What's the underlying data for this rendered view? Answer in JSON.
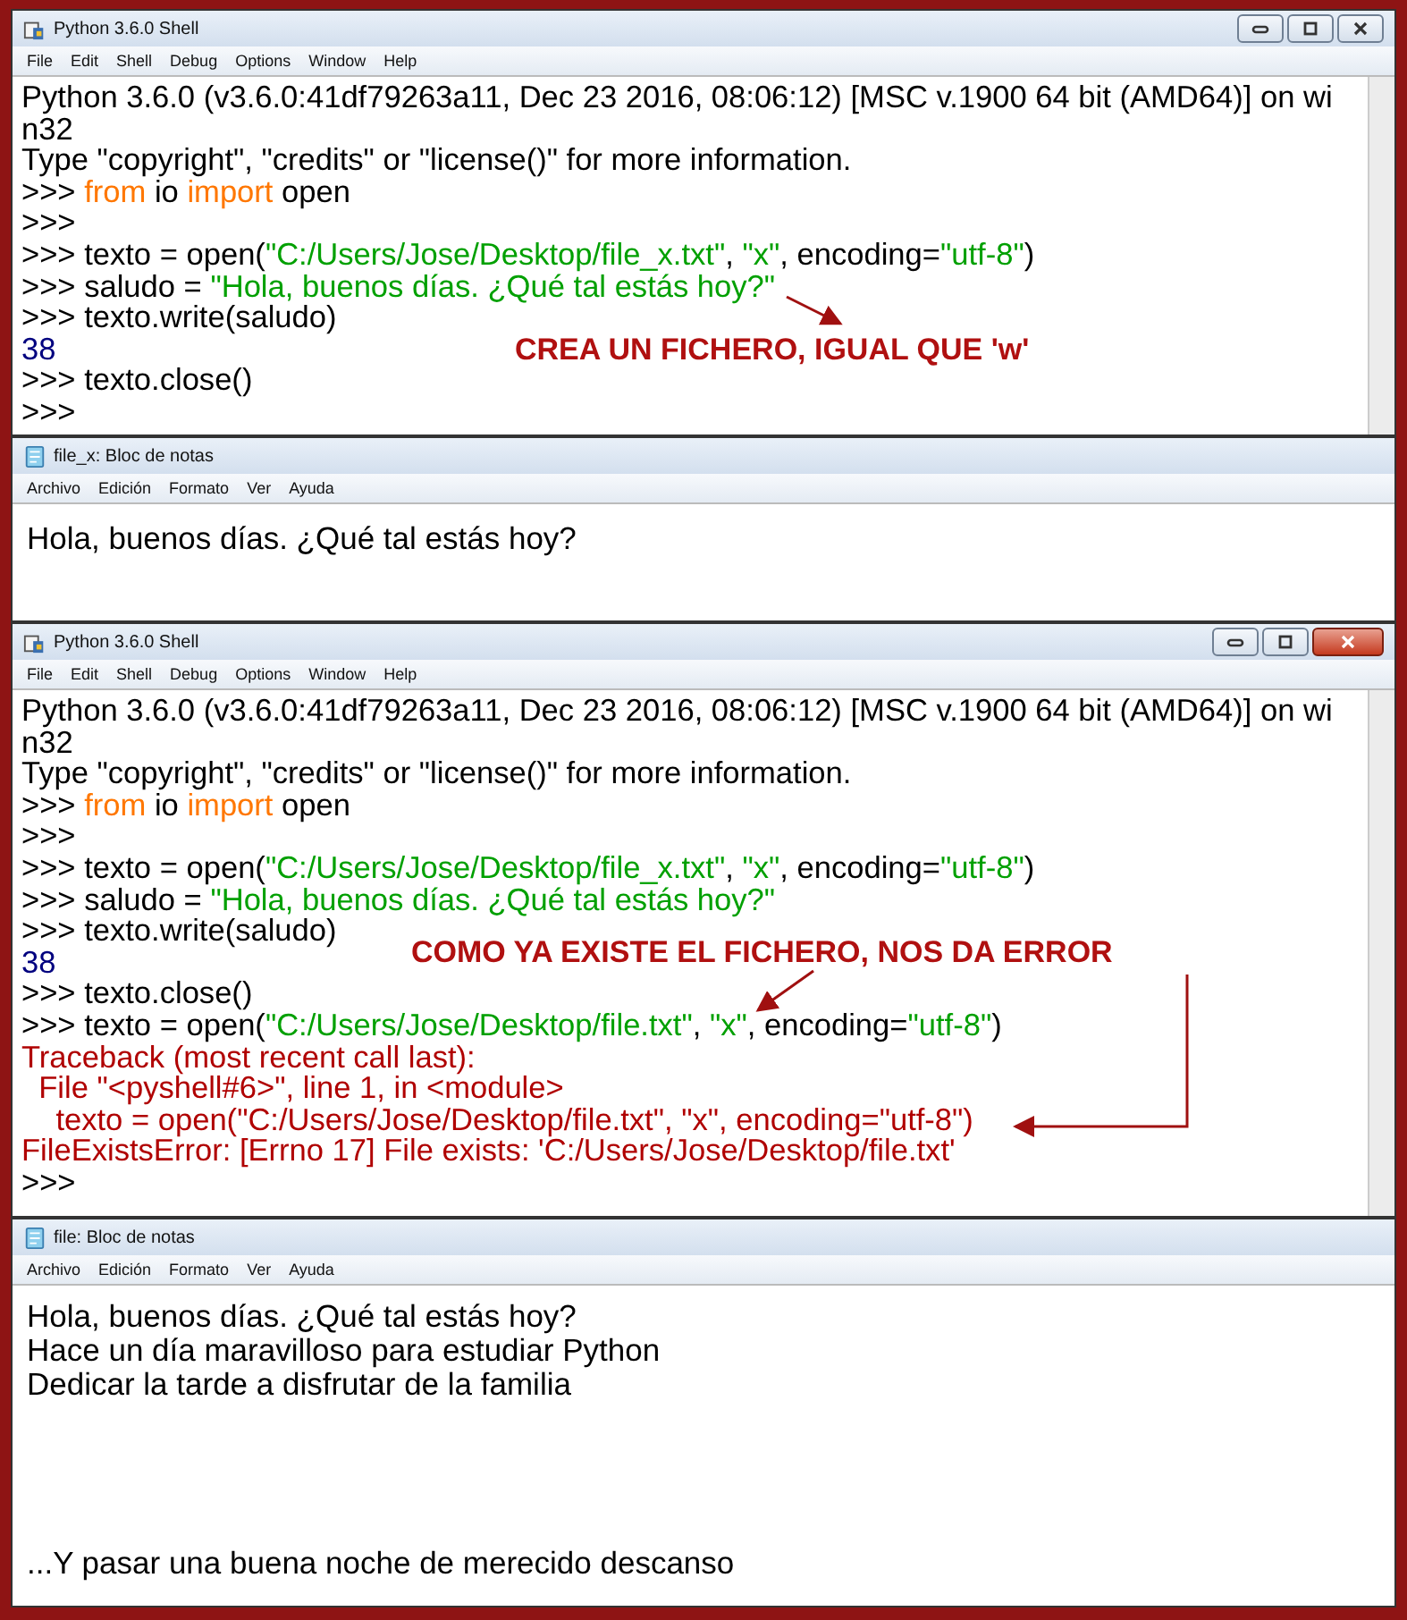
{
  "windows": [
    {
      "kind": "shell",
      "title": "Python 3.6.0 Shell",
      "active": false,
      "menu": [
        "File",
        "Edit",
        "Shell",
        "Debug",
        "Options",
        "Window",
        "Help"
      ],
      "lines": [
        {
          "segments": [
            {
              "kind": "plain",
              "text": "Python 3.6.0 (v3.6.0:41df79263a11, Dec 23 2016, 08:06:12) [MSC v.1900 64 bit (AMD64)] on wi"
            }
          ]
        },
        {
          "segments": [
            {
              "kind": "plain",
              "text": "n32"
            }
          ]
        },
        {
          "segments": [
            {
              "kind": "plain",
              "text": "Type \"copyright\", \"credits\" or \"license()\" for more information."
            }
          ]
        },
        {
          "segments": [
            {
              "kind": "plain",
              "text": ">>> "
            },
            {
              "kind": "keyword",
              "text": "from"
            },
            {
              "kind": "plain",
              "text": " io "
            },
            {
              "kind": "keyword",
              "text": "import"
            },
            {
              "kind": "plain",
              "text": " open"
            }
          ]
        },
        {
          "segments": [
            {
              "kind": "plain",
              "text": ">>>"
            }
          ]
        },
        {
          "segments": [
            {
              "kind": "plain",
              "text": ">>> texto = open("
            },
            {
              "kind": "string",
              "text": "\"C:/Users/Jose/Desktop/file_x.txt\""
            },
            {
              "kind": "plain",
              "text": ", "
            },
            {
              "kind": "string",
              "text": "\"x\""
            },
            {
              "kind": "plain",
              "text": ", encoding="
            },
            {
              "kind": "string",
              "text": "\"utf-8\""
            },
            {
              "kind": "plain",
              "text": ")"
            }
          ]
        },
        {
          "segments": [
            {
              "kind": "plain",
              "text": ">>> saludo = "
            },
            {
              "kind": "string",
              "text": "\"Hola, buenos días. ¿Qué tal estás hoy?\""
            }
          ]
        },
        {
          "segments": [
            {
              "kind": "plain",
              "text": ">>> texto.write(saludo)"
            }
          ]
        },
        {
          "segments": [
            {
              "kind": "output",
              "text": "38"
            }
          ],
          "note": "CREA UN FICHERO, IGUAL QUE 'w'"
        },
        {
          "segments": [
            {
              "kind": "plain",
              "text": ">>> texto.close()"
            }
          ]
        },
        {
          "segments": [
            {
              "kind": "plain",
              "text": ">>>"
            }
          ]
        }
      ]
    },
    {
      "kind": "notepad",
      "title": "file_x: Bloc de notas",
      "menu": [
        "Archivo",
        "Edición",
        "Formato",
        "Ver",
        "Ayuda"
      ],
      "text_lines": [
        "Hola, buenos días. ¿Qué tal estás hoy?"
      ]
    },
    {
      "kind": "shell",
      "title": "Python 3.6.0 Shell",
      "active": true,
      "menu": [
        "File",
        "Edit",
        "Shell",
        "Debug",
        "Options",
        "Window",
        "Help"
      ],
      "lines": [
        {
          "segments": [
            {
              "kind": "plain",
              "text": "Python 3.6.0 (v3.6.0:41df79263a11, Dec 23 2016, 08:06:12) [MSC v.1900 64 bit (AMD64)] on wi"
            }
          ]
        },
        {
          "segments": [
            {
              "kind": "plain",
              "text": "n32"
            }
          ]
        },
        {
          "segments": [
            {
              "kind": "plain",
              "text": "Type \"copyright\", \"credits\" or \"license()\" for more information."
            }
          ]
        },
        {
          "segments": [
            {
              "kind": "plain",
              "text": ">>> "
            },
            {
              "kind": "keyword",
              "text": "from"
            },
            {
              "kind": "plain",
              "text": " io "
            },
            {
              "kind": "keyword",
              "text": "import"
            },
            {
              "kind": "plain",
              "text": " open"
            }
          ]
        },
        {
          "segments": [
            {
              "kind": "plain",
              "text": ">>>"
            }
          ]
        },
        {
          "segments": [
            {
              "kind": "plain",
              "text": ">>> texto = open("
            },
            {
              "kind": "string",
              "text": "\"C:/Users/Jose/Desktop/file_x.txt\""
            },
            {
              "kind": "plain",
              "text": ", "
            },
            {
              "kind": "string",
              "text": "\"x\""
            },
            {
              "kind": "plain",
              "text": ", encoding="
            },
            {
              "kind": "string",
              "text": "\"utf-8\""
            },
            {
              "kind": "plain",
              "text": ")"
            }
          ]
        },
        {
          "segments": [
            {
              "kind": "plain",
              "text": ">>> saludo = "
            },
            {
              "kind": "string",
              "text": "\"Hola, buenos días. ¿Qué tal estás hoy?\""
            }
          ]
        },
        {
          "segments": [
            {
              "kind": "plain",
              "text": ">>> texto.write(saludo)"
            }
          ]
        },
        {
          "segments": [
            {
              "kind": "output",
              "text": "38"
            }
          ],
          "note": "COMO YA EXISTE EL FICHERO, NOS DA ERROR"
        },
        {
          "segments": [
            {
              "kind": "plain",
              "text": ">>> texto.close()"
            }
          ]
        },
        {
          "segments": [
            {
              "kind": "plain",
              "text": ">>> texto = open("
            },
            {
              "kind": "string",
              "text": "\"C:/Users/Jose/Desktop/file.txt\""
            },
            {
              "kind": "plain",
              "text": ", "
            },
            {
              "kind": "string",
              "text": "\"x\""
            },
            {
              "kind": "plain",
              "text": ", encoding="
            },
            {
              "kind": "string",
              "text": "\"utf-8\""
            },
            {
              "kind": "plain",
              "text": ")"
            }
          ]
        },
        {
          "segments": [
            {
              "kind": "error",
              "text": "Traceback (most recent call last):"
            }
          ]
        },
        {
          "segments": [
            {
              "kind": "error",
              "text": "  File \"<pyshell#6>\", line 1, in <module>"
            }
          ]
        },
        {
          "segments": [
            {
              "kind": "error",
              "text": "    texto = open(\"C:/Users/Jose/Desktop/file.txt\", \"x\", encoding=\"utf-8\")"
            }
          ]
        },
        {
          "segments": [
            {
              "kind": "error",
              "text": "FileExistsError: [Errno 17] File exists: 'C:/Users/Jose/Desktop/file.txt'"
            }
          ]
        },
        {
          "segments": [
            {
              "kind": "plain",
              "text": ">>>"
            }
          ]
        }
      ]
    },
    {
      "kind": "notepad",
      "title": "file: Bloc de notas",
      "menu": [
        "Archivo",
        "Edición",
        "Formato",
        "Ver",
        "Ayuda"
      ],
      "text_lines": [
        "Hola, buenos días. ¿Qué tal estás hoy?",
        "Hace un día maravilloso para estudiar Python",
        "Dedicar la tarde a disfrutar de la familia"
      ],
      "last_line": "...Y pasar una buena noche de merecido descanso"
    }
  ]
}
